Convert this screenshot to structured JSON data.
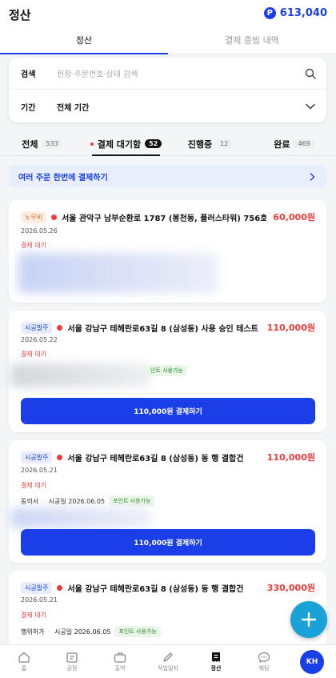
{
  "header": {
    "title": "정산",
    "points_symbol": "P",
    "points": "613,040"
  },
  "top_tabs": [
    {
      "label": "정산"
    },
    {
      "label": "결제 증빙 내역"
    }
  ],
  "filter": {
    "search_label": "검색",
    "search_placeholder": "현장·주문번호·상태 검색",
    "period_label": "기간",
    "period_value": "전체 기간"
  },
  "status_tabs": [
    {
      "label": "전체",
      "count": "533"
    },
    {
      "label": "결제 대기함",
      "count": "52"
    },
    {
      "label": "진행중",
      "count": "12"
    },
    {
      "label": "완료",
      "count": "469"
    }
  ],
  "bulk_banner": {
    "label": "여러 주문 한번에 결제하기"
  },
  "orders": [
    {
      "tag": "노무비",
      "address": "서울 관악구 남부순환로 1787 (봉천동, 플러스타워) 756호",
      "price": "60,000원",
      "date": "2026.05.26",
      "status": "결제 대기"
    },
    {
      "tag": "시공발주",
      "address": "서울 강남구 테헤란로63길 8 (삼성동) 사용 승인 테스트",
      "price": "110,000원",
      "date": "2026.05.22",
      "status": "결제 대기",
      "chip": "인트 사용가능",
      "button": "110,000원 결제하기"
    },
    {
      "tag": "시공발주",
      "address": "서울 강남구 테헤란로63길 8 (삼성동) 동 행 결합건",
      "price": "110,000원",
      "date": "2026.05.21",
      "status": "결제 대기",
      "meta_type": "동의서",
      "meta_date": "시공일 2026.06.05",
      "chip": "포인트 사용가능",
      "button": "110,000원 결제하기"
    },
    {
      "tag": "시공발주",
      "address": "서울 강남구 테헤란로63길 8 (삼성동) 동 행 결합건",
      "price": "330,000원",
      "date": "2026.05.21",
      "status": "결제 대기",
      "meta_type": "행위허가",
      "meta_date": "시공일 2026.06.05",
      "chip": "포인트 사용가능"
    }
  ],
  "bottom_nav": [
    {
      "label": "홈"
    },
    {
      "label": "공정"
    },
    {
      "label": "출역"
    },
    {
      "label": "작업일지"
    },
    {
      "label": "정산"
    },
    {
      "label": "채팅"
    }
  ],
  "profile": {
    "initials": "KH"
  },
  "colors": {
    "primary": "#1a3fe8",
    "danger": "#ef3b3b",
    "fab": "#1aa1d8"
  }
}
